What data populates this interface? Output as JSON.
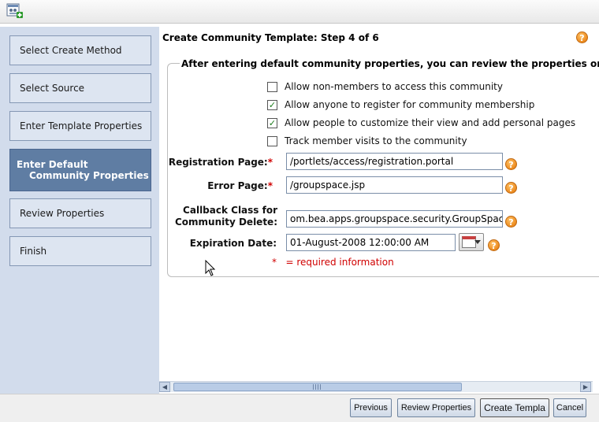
{
  "window": {
    "app_icon": "community-add-icon"
  },
  "wizard": {
    "steps": [
      {
        "label": "Select Create Method",
        "active": false
      },
      {
        "label": "Select Source",
        "active": false
      },
      {
        "label": "Enter Template Properties",
        "active": false
      },
      {
        "label_line1": "Enter Default",
        "label_line2": "Community Properties",
        "active": true
      },
      {
        "label": "Review Properties",
        "active": false
      },
      {
        "label": "Finish",
        "active": false
      }
    ]
  },
  "page": {
    "title": "Create Community Template: Step 4 of 6",
    "help_icon": "help-icon",
    "section_heading": "After entering default community properties, you can review the properties or c"
  },
  "options": [
    {
      "label": "Allow non-members to access this community",
      "checked": false
    },
    {
      "label": "Allow anyone to register for community membership",
      "checked": true
    },
    {
      "label": "Allow people to customize their view and add personal pages",
      "checked": true
    },
    {
      "label": "Track member visits to the community",
      "checked": false
    }
  ],
  "fields": {
    "registration_page": {
      "label": "Registration Page:",
      "required_mark": "*",
      "value": "/portlets/access/registration.portal"
    },
    "error_page": {
      "label": "Error Page:",
      "required_mark": "*",
      "value": "/groupspace.jsp"
    },
    "callback_class": {
      "label_line1": "Callback Class for",
      "label_line2": "Community Delete:",
      "value": "om.bea.apps.groupspace.security.GroupSpace"
    },
    "expiration_date": {
      "label": "Expiration Date:",
      "value": "01-August-2008 12:00:00 AM",
      "calendar_icon": "calendar-icon"
    }
  },
  "required_note": {
    "mark": "*",
    "text": "= required information"
  },
  "buttons": {
    "previous": "Previous",
    "review": "Review Properties",
    "create": "Create Templa",
    "cancel": "Cancel"
  },
  "colors": {
    "sidebar_bg": "#d2dcec",
    "active_step_bg": "#5f7da3",
    "required_red": "#d00000",
    "help_orange": "#ec8a1e"
  }
}
